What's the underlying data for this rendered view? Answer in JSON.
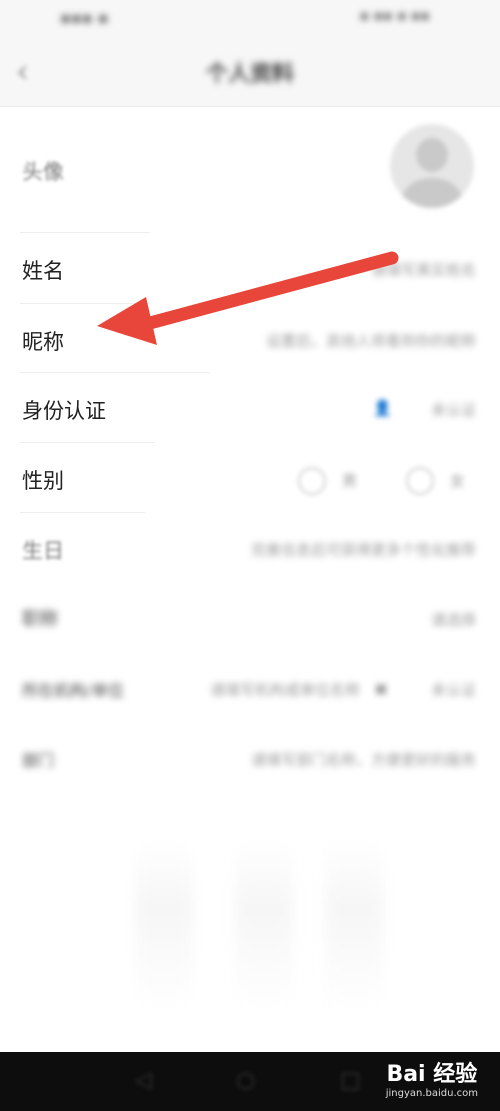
{
  "header": {
    "title": "个人资料"
  },
  "rows": {
    "avatar_label": "头像",
    "name_label": "姓名",
    "name_placeholder": "请填写真实姓名",
    "nickname_label": "昵称",
    "nickname_placeholder": "设置后，其他人将看到你的昵称",
    "identity_label": "身份认证",
    "identity_value": "未认证",
    "gender_label": "性别",
    "gender_male": "男",
    "gender_female": "女",
    "birthday_label": "生日",
    "birthday_placeholder": "完善信息后可获得更多个性化推荐",
    "title_label": "职称",
    "title_value": "请选择",
    "institution_label": "所在机构/单位",
    "institution_placeholder": "请填写机构或单位名称",
    "institution_value": "未认证",
    "department_label": "部门",
    "department_placeholder": "请填写部门名称，方便更好的服务"
  },
  "watermark": {
    "brand": "Bai 经验",
    "url": "jingyan.baidu.com"
  },
  "annotation": {
    "arrow_color": "#e8463a"
  }
}
